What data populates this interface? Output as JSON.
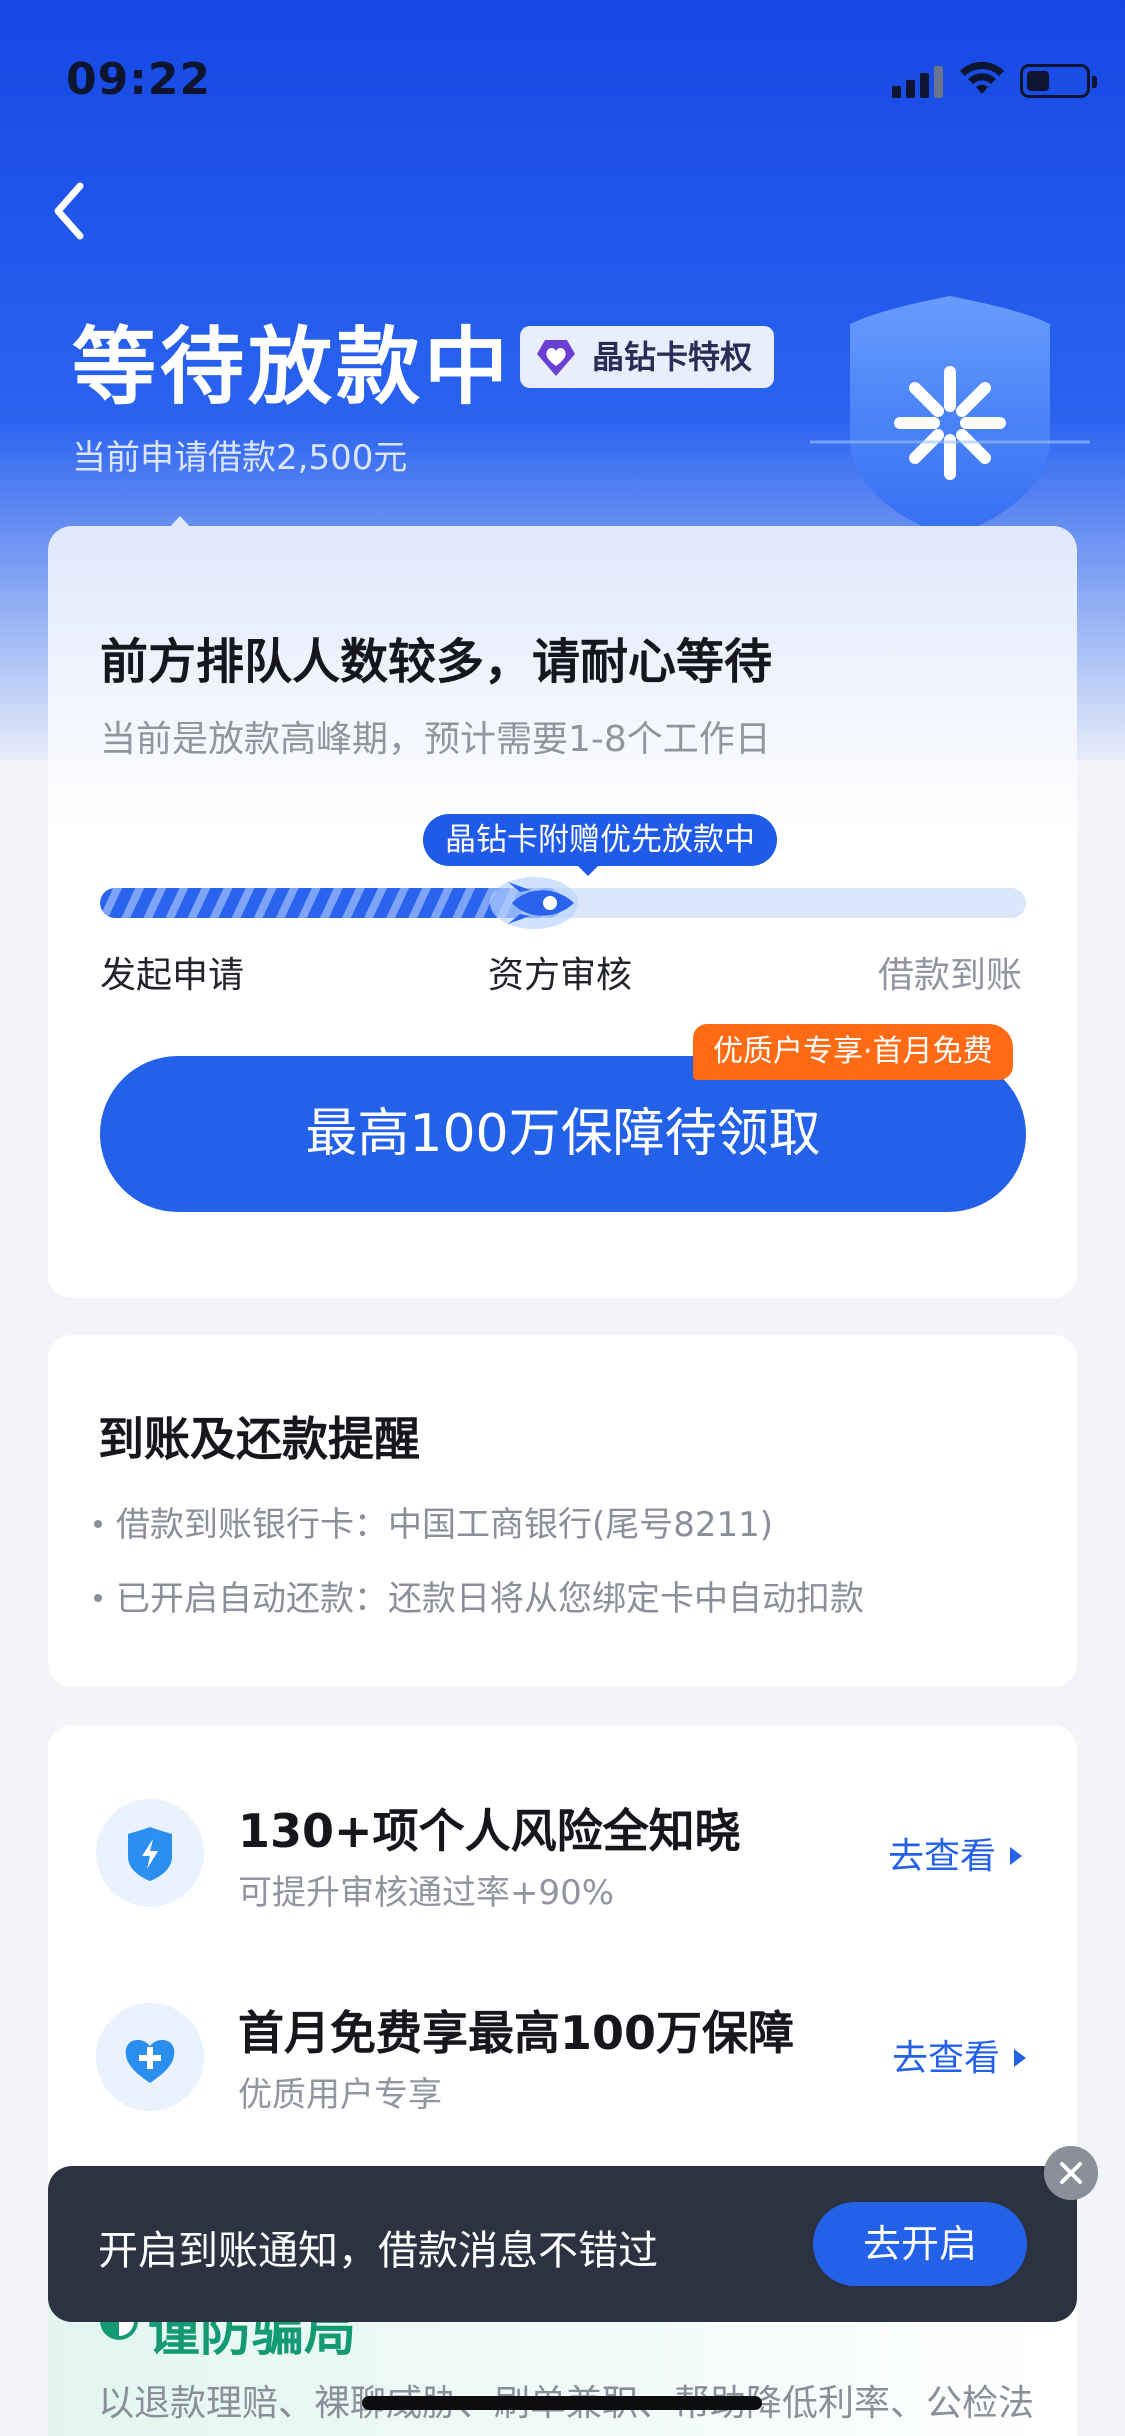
{
  "status_bar": {
    "time": "09:22"
  },
  "colors": {
    "primary": "#2461e9",
    "header_blue": "#1647e4",
    "promo_orange": "#ff6a14",
    "toast_bg": "#2c3242",
    "fraud_green": "#139a73"
  },
  "header": {
    "back_icon": "chevron-left-icon",
    "title": "等待放款中",
    "badge": "晶钻卡特权",
    "subtitle": "当前申请借款2,500元"
  },
  "progress_card": {
    "heading": "前方排队人数较多，请耐心等待",
    "subheading": "当前是放款高峰期，预计需要1-8个工作日",
    "tooltip": "晶钻卡附赠优先放款中",
    "progress_fraction": 0.5,
    "steps": [
      "发起申请",
      "资方审核",
      "借款到账"
    ],
    "cta_tag": "优质户专享·首月免费",
    "cta_label": "最高100万保障待领取"
  },
  "reminder_card": {
    "heading": "到账及还款提醒",
    "lines": [
      "借款到账银行卡：中国工商银行(尾号8211)",
      "已开启自动还款：还款日将从您绑定卡中自动扣款"
    ]
  },
  "services": [
    {
      "icon": "shield-bolt-icon",
      "title": "130+项个人风险全知晓",
      "subtitle": "可提升审核通过率+90%",
      "link": "去查看"
    },
    {
      "icon": "heart-plus-icon",
      "title": "首月免费享最高100万保障",
      "subtitle": "优质用户专享",
      "link": "去查看"
    }
  ],
  "fraud": {
    "title": "谨防骗局",
    "body": "以退款理赔、裸聊威胁、刷单兼职、帮助降低利率、公检法官方等名义诱导借款的都是骗局，请提高警惕"
  },
  "toast": {
    "text": "开启到账通知，借款消息不错过",
    "button": "去开启"
  }
}
